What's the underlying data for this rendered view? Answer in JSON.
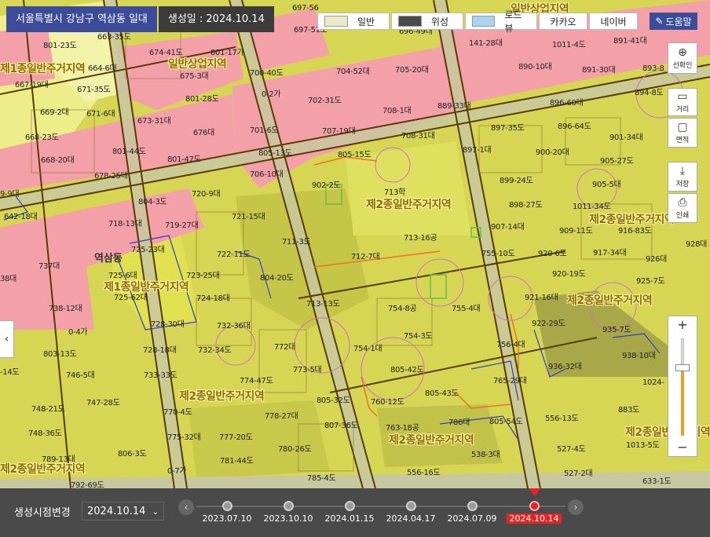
{
  "header": {
    "location": "서울특별시 강남구 역삼동 일대",
    "created": "생성일 : 2024.10.14"
  },
  "map_types": [
    {
      "label": "일반",
      "thumb_color": "#eaeac8"
    },
    {
      "label": "위성",
      "thumb_color": "#4a4a4a"
    },
    {
      "label": "로드뷰",
      "thumb_color": "#a8d4f0"
    },
    {
      "label": "카카오"
    },
    {
      "label": "네이버"
    }
  ],
  "help": {
    "label": "도움말",
    "icon": "pencil-icon"
  },
  "tools": {
    "select": {
      "label": "선확인",
      "icon": "plus-circle-icon"
    },
    "distance": {
      "label": "거리",
      "icon": "ruler-icon"
    },
    "area": {
      "label": "면적",
      "icon": "area-square-icon"
    },
    "save": {
      "label": "저장",
      "icon": "download-icon"
    },
    "print": {
      "label": "인쇄",
      "icon": "printer-icon"
    }
  },
  "zoom": {
    "plus": "+",
    "minus": "−",
    "level_fraction": 0.3
  },
  "nav": {
    "left_arrow": "‹"
  },
  "map": {
    "colors": {
      "base": "#d6d654",
      "commercial": "#f4a0a8",
      "residential1": "#eded8a",
      "residential2": "#cfcf4e",
      "park": "#b9b94e",
      "road": "#c8c8a0",
      "boundary": "#5a3a00"
    },
    "dong": "역삼동",
    "zones": [
      "제1종일반주거지역",
      "일반상업지역",
      "제2종일반주거지역",
      "제1종일반주거지역",
      "제2종일반주거지역",
      "제2종일반주거지역",
      "제2종일반주거지역",
      "제2종일반주거지역",
      "제2종일반주거지역",
      "일반상업지역",
      "제2종일반주거지역"
    ],
    "parcels": [
      "697-56",
      "697-51도",
      "696-49대",
      "801-23도",
      "663-35도",
      "674-41도",
      "801-17가",
      "675-3대",
      "664-6대",
      "667-19대",
      "671-35도",
      "669-2대",
      "801-28도",
      "671-6대",
      "673-31대",
      "676대",
      "668-23도",
      "801-44도",
      "801-47도",
      "668-20대",
      "678-25대",
      "720-9대",
      "804-3도",
      "642-18대",
      "718-13대",
      "719-27대",
      "721-15대",
      "722-11도",
      "725-23대",
      "737대",
      "725-6대",
      "723-25대",
      "725-62대",
      "724-18대",
      "738-12대",
      "728-30대",
      "732-36대",
      "0-4가",
      "803-13도",
      "728-18대",
      "732-34도",
      "746-5대",
      "733-33도",
      "774-47도",
      "747-28도",
      "748-21도",
      "770-4도",
      "778-27대",
      "748-36도",
      "775-32대",
      "777-20도",
      "789-13대",
      "806-3도",
      "781-44도",
      "0-7가",
      "792-69도",
      "700-40도",
      "704-52대",
      "705-20대",
      "0-2가",
      "702-31도",
      "708-1대",
      "701-6도",
      "707-19대",
      "708-31대",
      "805-13도",
      "805-15도",
      "706-10대",
      "902-2도",
      "713학",
      "711-3도",
      "713-16공",
      "712-7대",
      "804-20도",
      "713-13도",
      "754-8공",
      "755-4대",
      "754-3도",
      "754-1대",
      "772대",
      "773-5대",
      "805-42도",
      "805-32도",
      "805-43도",
      "760-12도",
      "807-36도",
      "763-18공",
      "786대",
      "780-26도",
      "785-4도",
      "556-16도",
      "538-3대",
      "141-28대",
      "1011-4도",
      "891-41대",
      "890-10대",
      "891-30대",
      "893-8",
      "889-33대",
      "896-60대",
      "894-8도",
      "897-35도",
      "896-64도",
      "901-34대",
      "897-1대",
      "900-20대",
      "905-27도",
      "899-24도",
      "905-5대",
      "898-27도",
      "1011-34도",
      "907-14대",
      "909-11도",
      "916-83도",
      "755-10도",
      "920-6도",
      "917-34대",
      "926대",
      "920-19도",
      "925-7도",
      "921-16대",
      "922-29도",
      "935-7도",
      "756-4대",
      "936-32대",
      "938-10대",
      "765-29대",
      "805-54도",
      "556-13도",
      "883도",
      "527-4도",
      "1013-5도",
      "527-2대",
      "633-1도",
      "928대",
      "1024-",
      "38대",
      "9-9대",
      "-14도"
    ]
  },
  "timeline": {
    "label": "생성시점변경",
    "selected": "2024.10.14",
    "prev": "‹",
    "next": "›",
    "dates": [
      "2023.07.10",
      "2023.10.10",
      "2024.01.15",
      "2024.04.17",
      "2024.07.09",
      "2024.10.14"
    ],
    "active_index": 5
  }
}
